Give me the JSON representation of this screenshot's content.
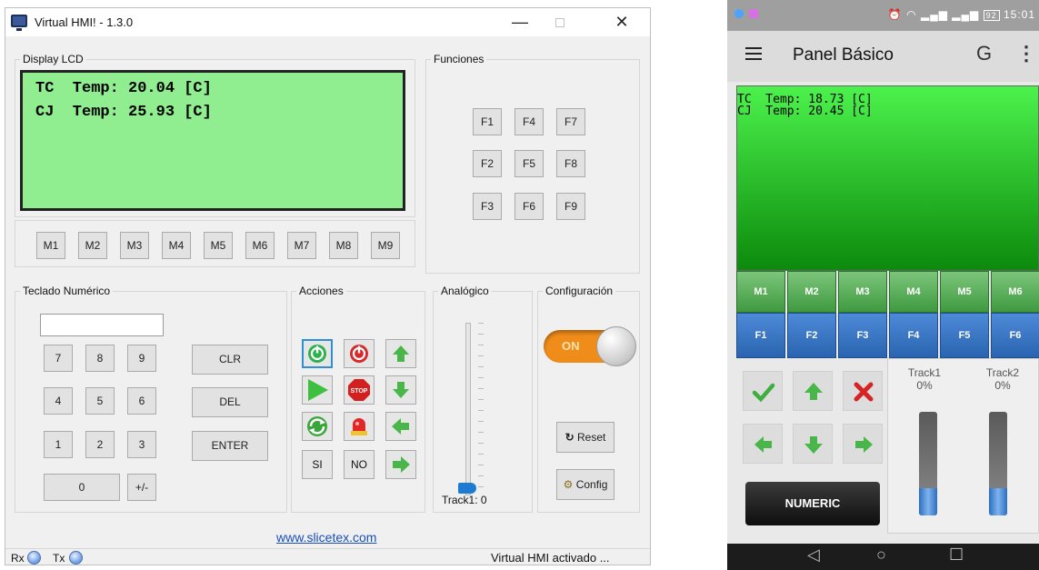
{
  "window": {
    "title": "Virtual HMI! - 1.3.0",
    "minimize": "—",
    "close": "✕"
  },
  "lcd": {
    "group_label": "Display LCD",
    "line1": "TC  Temp: 20.04 [C]",
    "line2": "CJ  Temp: 25.93 [C]"
  },
  "functions": {
    "group_label": "Funciones",
    "buttons": [
      "F1",
      "F4",
      "F7",
      "F2",
      "F5",
      "F8",
      "F3",
      "F6",
      "F9"
    ]
  },
  "memory_buttons": [
    "M1",
    "M2",
    "M3",
    "M4",
    "M5",
    "M6",
    "M7",
    "M8",
    "M9"
  ],
  "keypad": {
    "group_label": "Teclado Numérico",
    "input_value": "",
    "keys": [
      "7",
      "8",
      "9",
      "4",
      "5",
      "6",
      "1",
      "2",
      "3"
    ],
    "zero": "0",
    "plusminus": "+/-",
    "clr": "CLR",
    "del": "DEL",
    "enter": "ENTER"
  },
  "actions": {
    "group_label": "Acciones",
    "si": "SI",
    "no": "NO",
    "stop": "STOP"
  },
  "analog": {
    "group_label": "Analógico",
    "track_label": "Track1: 0",
    "value": 0
  },
  "config": {
    "group_label": "Configuración",
    "toggle_text": "ON",
    "reset": "Reset",
    "config": "Config"
  },
  "footer": {
    "link": "www.slicetex.com",
    "rx": "Rx",
    "tx": "Tx",
    "status": "Virtual HMI activado ..."
  },
  "phone": {
    "status_right": "15:01",
    "battery": "92",
    "title": "Panel Básico",
    "lcd_line1": "TC  Temp: 18.73 [C]",
    "lcd_line2": "CJ  Temp: 20.45 [C]",
    "m_buttons": [
      "M1",
      "M2",
      "M3",
      "M4",
      "M5",
      "M6"
    ],
    "f_buttons": [
      "F1",
      "F2",
      "F3",
      "F4",
      "F5",
      "F6"
    ],
    "track1_label": "Track1",
    "track1_value": "0%",
    "track2_label": "Track2",
    "track2_value": "0%",
    "numeric": "NUMERIC"
  },
  "colors": {
    "lcd_bg": "#90ee90",
    "toggle": "#f08c1a",
    "phone_m": "#4fa24f",
    "phone_f": "#2f6fbf",
    "slider": "#1d7bd1"
  }
}
